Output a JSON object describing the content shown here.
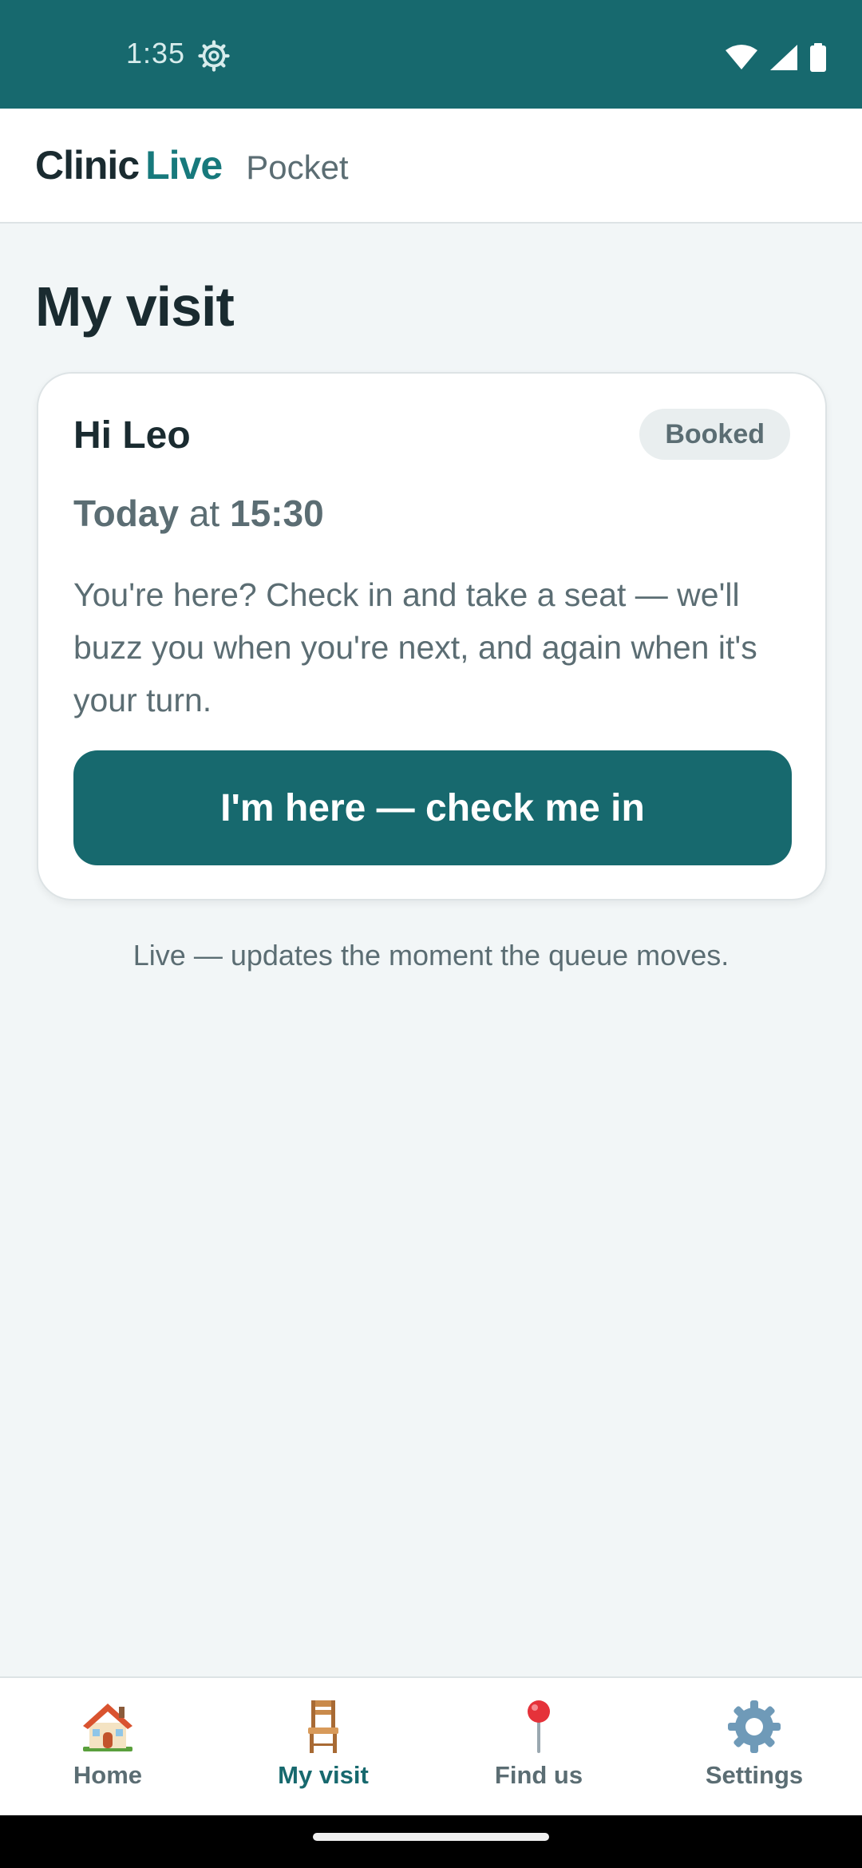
{
  "status_bar": {
    "time": "1:35",
    "background": "#17696e",
    "icons": [
      "settings-gear-icon",
      "wifi-icon",
      "cell-signal-icon",
      "battery-icon"
    ]
  },
  "header": {
    "brand_part1": "Clinic",
    "brand_part2": "Live",
    "subtitle": "Pocket",
    "accent": "#17797c"
  },
  "page": {
    "title": "My visit"
  },
  "card": {
    "greeting": "Hi Leo",
    "badge": "Booked",
    "day": "Today",
    "at": "at",
    "time": "15:30",
    "description": "You're here? Check in and take a seat — we'll buzz you when you're next, and again when it's your turn.",
    "button_label": "I'm here — check me in",
    "button_color": "#17696e"
  },
  "footer_note": "Live — updates the moment the queue moves.",
  "nav": {
    "active": "My visit",
    "items": [
      {
        "label": "Home",
        "icon": "house-icon"
      },
      {
        "label": "My visit",
        "icon": "chair-icon"
      },
      {
        "label": "Find us",
        "icon": "map-pin-icon"
      },
      {
        "label": "Settings",
        "icon": "gear-icon"
      }
    ]
  }
}
